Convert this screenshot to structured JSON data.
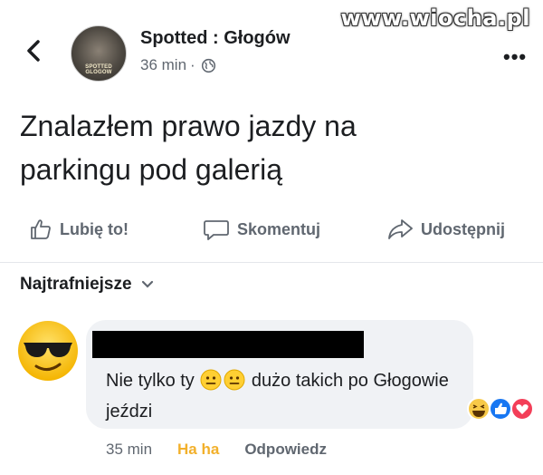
{
  "watermark": "www.wiocha.pl",
  "header": {
    "back_icon": "chevron-left-icon",
    "page_name": "Spotted : Głogów",
    "avatar_text": "SPOTTED GLOGOW",
    "time": "36 min",
    "separator": "·",
    "privacy_icon": "globe-icon",
    "more_icon": "more-horizontal-icon",
    "more_label": "•••"
  },
  "post": {
    "text": "Znalazłem prawo jazdy na\nparkingu pod galerią"
  },
  "actions": {
    "like": "Lubię to!",
    "comment": "Skomentuj",
    "share": "Udostępnij"
  },
  "comments": {
    "sort_label": "Najtrafniejsze",
    "items": [
      {
        "avatar_icon": "sunglasses-emoji-icon",
        "author_redacted": true,
        "text_part1": "Nie tylko ty",
        "emojis": [
          "neutral-face-icon",
          "neutral-face-icon"
        ],
        "text_part2": " dużo takich po Głogowie jeździ",
        "reactions": [
          "haha-reaction-icon",
          "like-reaction-icon",
          "love-reaction-icon"
        ],
        "time": "35 min",
        "reaction_label": "Ha ha",
        "reply_label": "Odpowiedz"
      }
    ]
  },
  "colors": {
    "text": "#1c1e21",
    "muted": "#606770",
    "bubble": "#f0f2f5",
    "haha": "#f2b02b",
    "like": "#1877f2",
    "love": "#f33e58"
  }
}
